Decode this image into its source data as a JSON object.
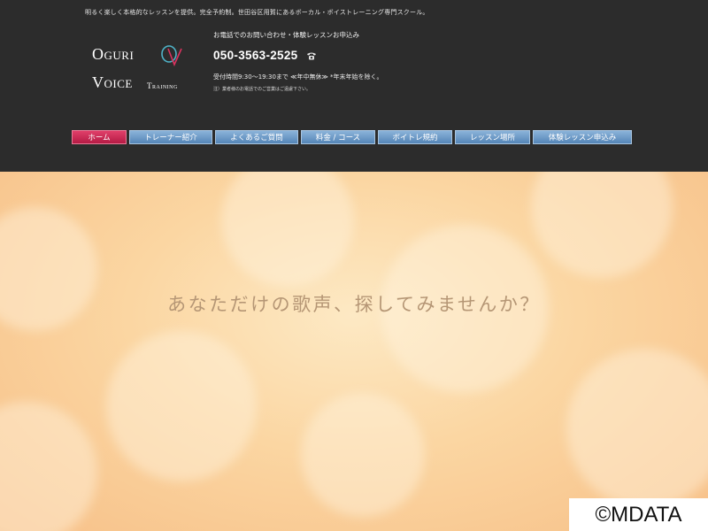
{
  "header": {
    "tagline": "明るく楽しく本格的なレッスンを提供。完全予約制。世田谷区用賀にあるボーカル・ボイストレーニング専門スクール。",
    "logo": {
      "line1": "Oguri",
      "line2": "Voice",
      "line2_small": "Training",
      "mark_letters": "OV",
      "mark_colors": [
        "#4fb3c8",
        "#d9325e"
      ]
    },
    "contact": {
      "lead": "お電話でのお問い合わせ・体験レッスンお申込み",
      "phone": "050-3563-2525",
      "phone_icon": "telephone-icon",
      "hours": "受付時間9:30～19:30まで ≪年中無休≫ *年末年始を除く。",
      "note": "注）業者様のお電話でのご営業はご遠慮下さい。"
    }
  },
  "nav": {
    "items": [
      {
        "label": "ホーム",
        "active": true
      },
      {
        "label": "トレーナー紹介"
      },
      {
        "label": "よくあるご質問"
      },
      {
        "label": "料金 / コース"
      },
      {
        "label": "ボイトレ規約"
      },
      {
        "label": "レッスン場所"
      },
      {
        "label": "体験レッスン申込み"
      }
    ]
  },
  "hero": {
    "title": "あなただけの歌声、探してみませんか？"
  },
  "watermark": "©MDATA",
  "colors": {
    "header_bg": "#2c2c2c",
    "nav_blue": "#6d9ccb",
    "nav_active": "#c9244f",
    "hero_text": "#b59675"
  }
}
